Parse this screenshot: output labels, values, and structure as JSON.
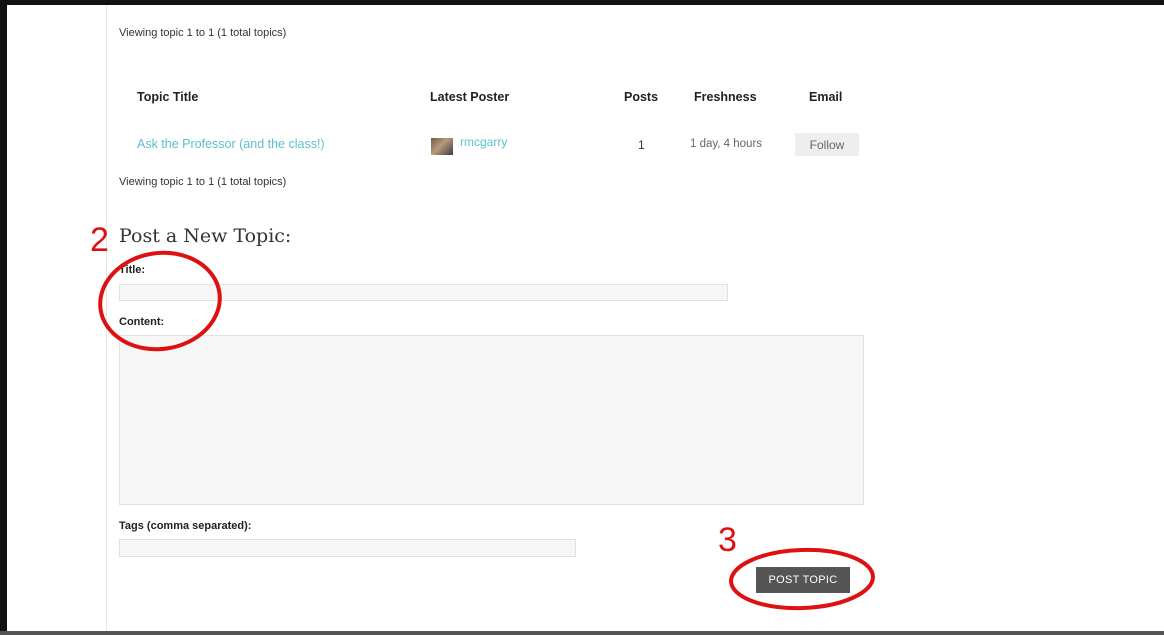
{
  "forum": {
    "viewing_top": "Viewing topic 1 to 1 (1 total topics)",
    "viewing_bottom": "Viewing topic 1 to 1 (1 total topics)",
    "columns": [
      "Topic Title",
      "Latest Poster",
      "Posts",
      "Freshness",
      "Email"
    ],
    "topics": [
      {
        "title": "Ask the Professor (and the class!)",
        "latest_poster": "rmcgarry",
        "posts": "1",
        "freshness": "1 day, 4 hours",
        "email_action": "Follow"
      }
    ]
  },
  "new_topic_form": {
    "heading": "Post a New Topic:",
    "title_label": "Title:",
    "title_value": "",
    "content_label": "Content:",
    "content_value": "",
    "tags_label": "Tags (comma separated):",
    "tags_value": "",
    "submit_label": "POST TOPIC"
  },
  "annotations": {
    "marker_2": "2",
    "marker_3": "3",
    "color": "#dd1111"
  },
  "colors": {
    "link": "#5bc0cd",
    "button_dark": "#555555",
    "field_bg": "#f6f6f6"
  }
}
